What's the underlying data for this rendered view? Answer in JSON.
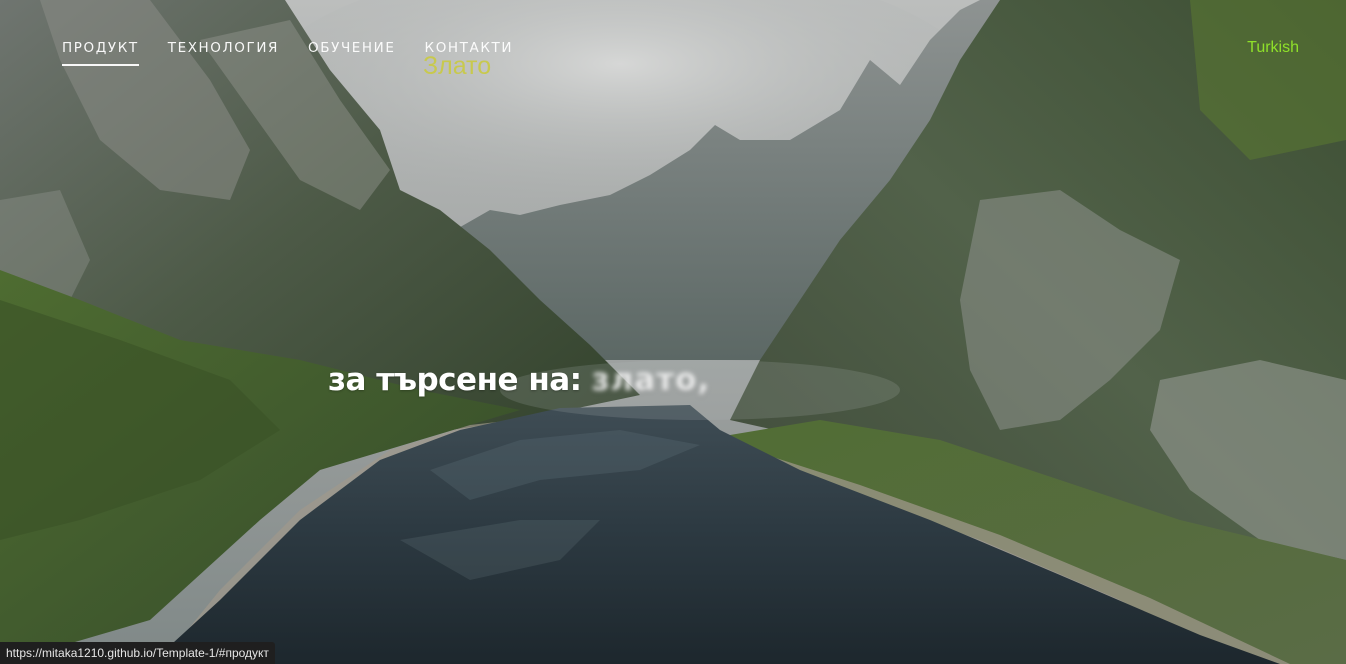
{
  "nav": {
    "items": [
      {
        "label": "ПРОДУКТ",
        "active": true
      },
      {
        "label": "ТЕХНОЛОГИЯ",
        "active": false
      },
      {
        "label": "ОБУЧЕНИЕ",
        "active": false
      },
      {
        "label": "КОНТАКТИ",
        "active": false
      }
    ]
  },
  "logo": {
    "text": "Злато",
    "color": "#c8c94e"
  },
  "language": {
    "label": "Turkish",
    "color": "#8fe02a"
  },
  "hero": {
    "static_text": "за търсене на:",
    "rotating_text": "злато,"
  },
  "status_bar": {
    "url": "https://mitaka1210.github.io/Template-1/#продукт"
  },
  "background": {
    "scene": "mountain-lake-valley-image"
  }
}
